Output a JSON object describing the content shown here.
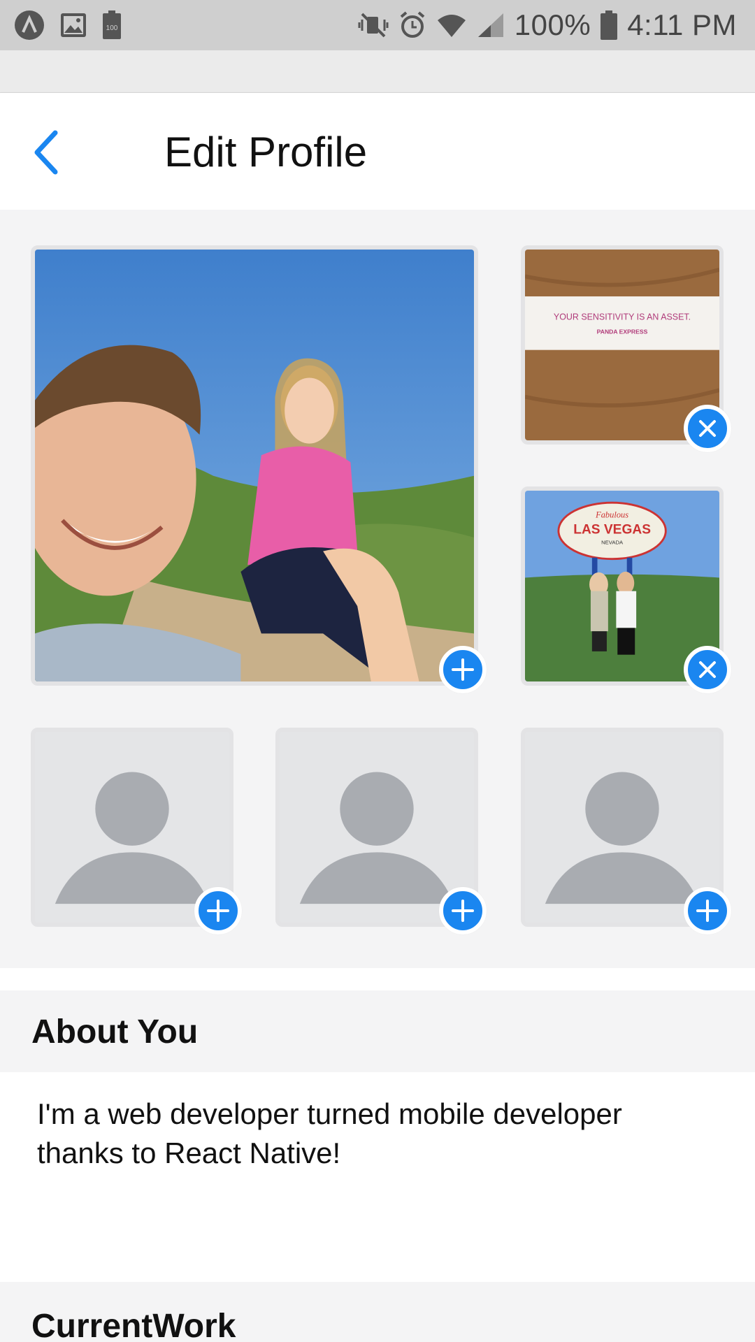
{
  "status_bar": {
    "battery_percent": "100%",
    "time": "4:11 PM",
    "left_icons": [
      "app-notification-icon",
      "gallery-icon",
      "battery-saver-icon"
    ],
    "battery_saver_label": "100",
    "right_icons": [
      "mute-vibrate-icon",
      "alarm-icon",
      "wifi-icon",
      "signal-icon",
      "battery-icon"
    ]
  },
  "header": {
    "title": "Edit Profile",
    "back_icon": "chevron-left-icon"
  },
  "photos": {
    "main": {
      "action": "add"
    },
    "slot2": {
      "action": "remove",
      "caption": "YOUR SENSITIVITY IS AN ASSET.",
      "subcaption": "PANDA EXPRESS"
    },
    "slot3": {
      "action": "remove",
      "sign_top": "Fabulous",
      "sign_main": "LAS VEGAS",
      "sign_bottom": "NEVADA"
    },
    "slot4": {
      "action": "add"
    },
    "slot5": {
      "action": "add"
    },
    "slot6": {
      "action": "add"
    }
  },
  "about": {
    "heading": "About You",
    "text": "I'm a web developer turned mobile developer thanks to React Native!"
  },
  "current_work": {
    "heading": "CurrentWork"
  },
  "colors": {
    "accent": "#1a86f0",
    "placeholder": "#a9acb1",
    "placeholder_bg": "#e4e5e7"
  }
}
